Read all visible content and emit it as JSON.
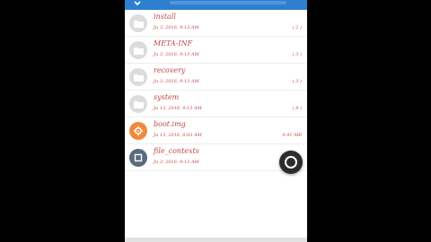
{
  "colors": {
    "accent": "#2f7fd0",
    "text": "#c24848",
    "folder_icon_bg": "#dcdcdc",
    "orange_icon_bg": "#f08a3a",
    "slate_icon_bg": "#5a6b7e",
    "fab_bg": "#2c2c2c"
  },
  "files": [
    {
      "name": "install",
      "date": "Ju 3, 2016, 9:13 AM",
      "meta": "( 2 )",
      "icon": "folder-icon"
    },
    {
      "name": "META-INF",
      "date": "Ju 3, 2016, 9:13 AM",
      "meta": "( 3 )",
      "icon": "folder-icon"
    },
    {
      "name": "recovery",
      "date": "Ju 3, 2016, 9:13 AM",
      "meta": "( 3 )",
      "icon": "folder-icon"
    },
    {
      "name": "system",
      "date": "Ju 13, 2016, 9:13 AM",
      "meta": "( 8 )",
      "icon": "folder-icon"
    },
    {
      "name": "boot.img",
      "date": "Ju 13, 2016, 8:03 AM",
      "meta": "9.41 MB",
      "icon": "gear-icon"
    },
    {
      "name": "file_contexts",
      "date": "Ju 3, 2016, 9:13 AM",
      "meta": "",
      "icon": "file-icon"
    }
  ],
  "fab": {
    "icon": "circle-icon"
  }
}
